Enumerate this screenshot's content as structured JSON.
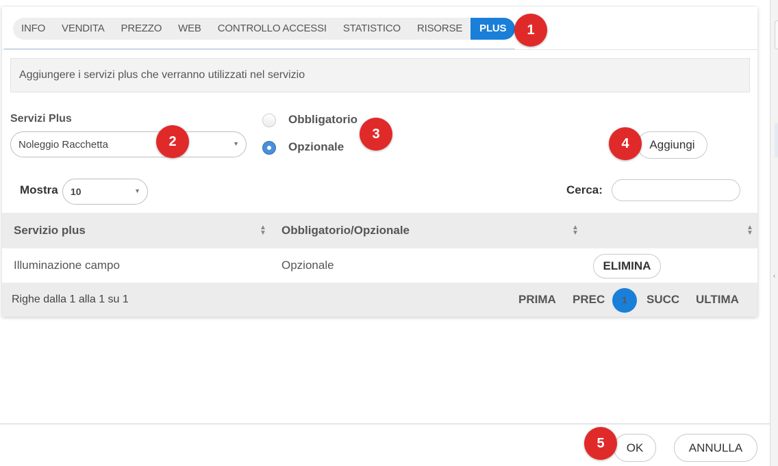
{
  "tabs": [
    {
      "label": "INFO"
    },
    {
      "label": "VENDITA"
    },
    {
      "label": "PREZZO"
    },
    {
      "label": "WEB"
    },
    {
      "label": "CONTROLLO ACCESSI"
    },
    {
      "label": "STATISTICO"
    },
    {
      "label": "RISORSE"
    },
    {
      "label": "PLUS",
      "active": true
    }
  ],
  "info_message": "Aggiungere i servizi plus che verranno utilizzati nel servizio",
  "form": {
    "servizi_label": "Servizi Plus",
    "servizi_selected": "Noleggio Racchetta",
    "radio_obbligatorio": "Obbligatorio",
    "radio_opzionale": "Opzionale",
    "selected_radio": "Opzionale",
    "add_button": "Aggiungi"
  },
  "list_controls": {
    "show_label": "Mostra",
    "show_value": "10",
    "search_label": "Cerca:",
    "search_value": ""
  },
  "table": {
    "columns": [
      "Servizio plus",
      "Obbligatorio/Opzionale",
      ""
    ],
    "rows": [
      {
        "servizio": "Illuminazione campo",
        "tipo": "Opzionale",
        "action": "ELIMINA"
      }
    ]
  },
  "pagination": {
    "summary": "Righe dalla 1 alla 1 su 1",
    "first": "PRIMA",
    "prev": "PREC",
    "current": "1",
    "next": "SUCC",
    "last": "ULTIMA"
  },
  "dialog_buttons": {
    "ok": "OK",
    "cancel": "ANNULLA"
  },
  "annotations": [
    "1",
    "2",
    "3",
    "4",
    "5"
  ],
  "colors": {
    "accent": "#1a7fd8",
    "badge": "#e02a2a"
  }
}
